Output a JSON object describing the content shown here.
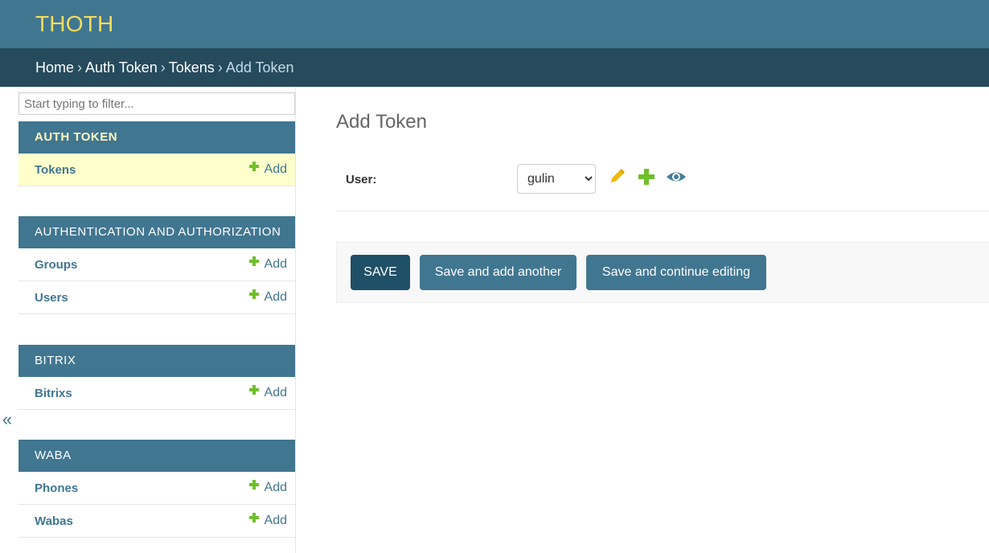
{
  "header": {
    "site_name": "THOTH"
  },
  "breadcrumbs": {
    "items": [
      "Home",
      "Auth Token",
      "Tokens"
    ],
    "separator": "›",
    "current": "Add Token"
  },
  "sidebar": {
    "filter_placeholder": "Start typing to filter...",
    "toggle_glyph": "«",
    "modules": [
      {
        "caption": "AUTH TOKEN",
        "models": [
          {
            "label": "Tokens",
            "add": "Add"
          }
        ]
      },
      {
        "caption": "AUTHENTICATION AND AUTHORIZATION",
        "models": [
          {
            "label": "Groups",
            "add": "Add"
          },
          {
            "label": "Users",
            "add": "Add"
          }
        ]
      },
      {
        "caption": "BITRIX",
        "models": [
          {
            "label": "Bitrixs",
            "add": "Add"
          }
        ]
      },
      {
        "caption": "WABA",
        "models": [
          {
            "label": "Phones",
            "add": "Add"
          },
          {
            "label": "Wabas",
            "add": "Add"
          }
        ]
      }
    ]
  },
  "content": {
    "title": "Add Token",
    "field_label": "User:",
    "user_value": "gulin",
    "related_icons": [
      "pencil-icon",
      "plus-icon",
      "eye-icon"
    ],
    "buttons": {
      "save": "SAVE",
      "save_add_another": "Save and add another",
      "save_continue": "Save and continue editing"
    }
  },
  "colors": {
    "header": "#417690",
    "breadcrumbs": "#264b5d",
    "site_name": "#f5dd5d",
    "current_row": "#ffffcc",
    "add_icon": "#70bf2b"
  }
}
